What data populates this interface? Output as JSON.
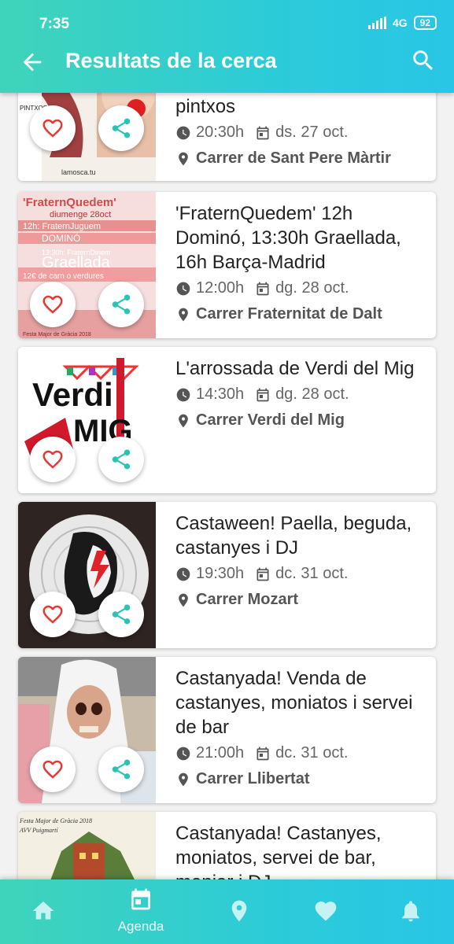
{
  "status_bar": {
    "time": "7:35",
    "network": "4G",
    "battery": "92"
  },
  "app_bar": {
    "title": "Resultats de la cerca"
  },
  "events": [
    {
      "title": "pintxos",
      "time": "20:30h",
      "date": "ds. 27 oct.",
      "place": "Carrer de Sant Pere Màrtir"
    },
    {
      "title": "'FraternQuedem' 12h Dominó, 13:30h Graellada, 16h Barça-Madrid",
      "time": "12:00h",
      "date": "dg. 28 oct.",
      "place": "Carrer Fraternitat de Dalt"
    },
    {
      "title": "L'arrossada de Verdi del Mig",
      "time": "14:30h",
      "date": "dg. 28 oct.",
      "place": "Carrer Verdi del Mig"
    },
    {
      "title": "Castaween! Paella, beguda, castanyes i DJ",
      "time": "19:30h",
      "date": "dc. 31 oct.",
      "place": "Carrer Mozart"
    },
    {
      "title": "Castanyada! Venda de castanyes, moniatos i servei de bar",
      "time": "21:00h",
      "date": "dc. 31 oct.",
      "place": "Carrer Llibertat"
    },
    {
      "title": "Castanyada! Castanyes, moniatos, servei de bar, menjar i DJ",
      "time": "",
      "date": "",
      "place": ""
    }
  ],
  "poster_texts": {
    "e1": {
      "top": "PINTXOS",
      "bottom": "lamosca.tu"
    },
    "e2": {
      "title": "'FraternQuedem'",
      "date": "diumenge 28oct",
      "l1": "12h: FraternJuguem",
      "l2": "DOMINÓ",
      "l3": "13:30h: FraternDinem",
      "l4": "Graellada",
      "l5": "12€ de carn o verdures",
      "l6": "Festa Major de Gràcia 2018"
    },
    "e3": {
      "line1": "Verdi",
      "line2": "MIG"
    },
    "e6": {
      "line1": "Festa Major de Gràcia 2018",
      "line2": "AVV Puigmartí"
    }
  },
  "bottom_nav": {
    "agenda_label": "Agenda"
  },
  "colors": {
    "accent": "#2cc9d3",
    "heart": "#e53935",
    "share": "#2bc4b4"
  },
  "icons": {
    "back": "arrow-left-icon",
    "search": "search-icon",
    "clock": "clock-icon",
    "calendar": "calendar-icon",
    "place": "location-pin-icon",
    "favorite": "heart-icon",
    "share": "share-icon",
    "nav": [
      "home-icon",
      "calendar-icon",
      "map-pin-icon",
      "heart-icon",
      "bell-icon"
    ]
  }
}
